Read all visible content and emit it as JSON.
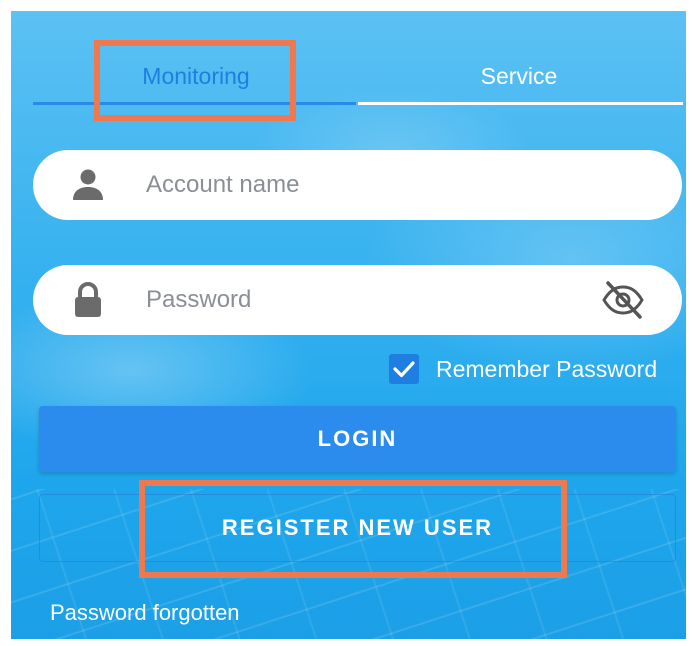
{
  "tabs": {
    "monitoring": "Monitoring",
    "service": "Service"
  },
  "login_form": {
    "account_placeholder": "Account name",
    "password_placeholder": "Password",
    "remember_label": "Remember Password",
    "remember_checked": true,
    "login_button": "LOGIN",
    "register_button": "REGISTER NEW USER",
    "forgot_link": "Password forgotten"
  },
  "icons": {
    "account": "user-icon",
    "password": "lock-icon",
    "visibility": "eye-off-icon",
    "checkbox": "check-icon"
  },
  "colors": {
    "accent": "#1e7fe0",
    "login_button": "#2c8cee",
    "highlight": "#f0784e"
  }
}
